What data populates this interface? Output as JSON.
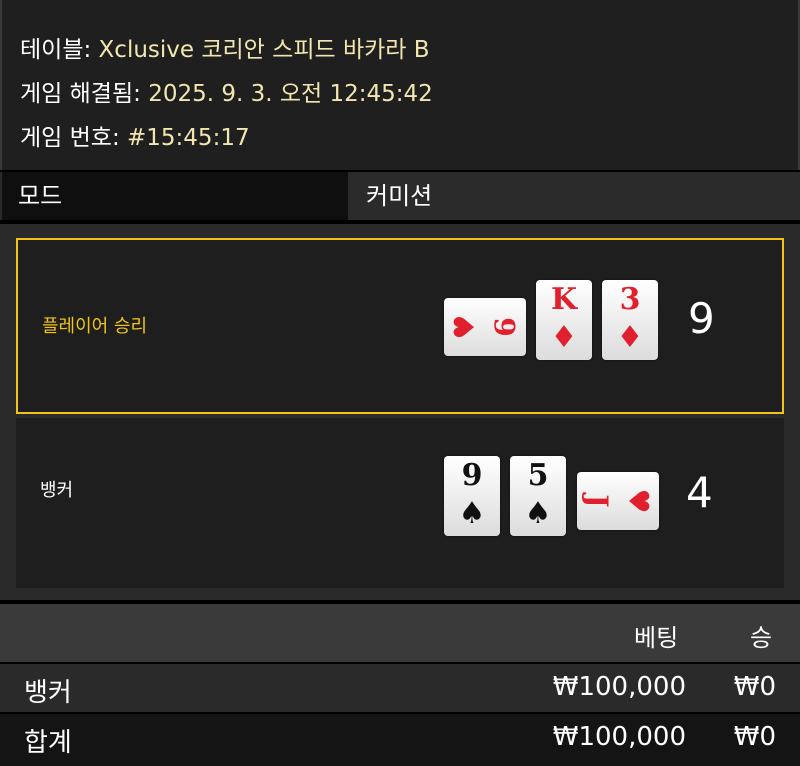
{
  "info": {
    "table_label": "테이블:",
    "table_value": "Xclusive 코리안 스피드 바카라 B",
    "resolved_label": "게임 해결됨:",
    "resolved_value": "2025. 9. 3. 오전 12:45:42",
    "game_no_label": "게임 번호:",
    "game_no_value": "#15:45:17"
  },
  "mode": {
    "label": "모드",
    "value": "커미션"
  },
  "results": {
    "player": {
      "label": "플레이어 승리",
      "score": "9",
      "cards": [
        {
          "rank": "6",
          "suit": "♥",
          "color": "#e0202c",
          "orientation": "horizontal"
        },
        {
          "rank": "K",
          "suit": "♦",
          "color": "#e0202c",
          "orientation": "vertical"
        },
        {
          "rank": "3",
          "suit": "♦",
          "color": "#e0202c",
          "orientation": "vertical"
        }
      ]
    },
    "banker": {
      "label": "뱅커",
      "score": "4",
      "cards": [
        {
          "rank": "9",
          "suit": "♠",
          "color": "#111111",
          "orientation": "vertical"
        },
        {
          "rank": "5",
          "suit": "♠",
          "color": "#111111",
          "orientation": "vertical"
        },
        {
          "rank": "J",
          "suit": "♥",
          "color": "#e0202c",
          "orientation": "horizontal"
        }
      ]
    },
    "winner_accent": "#f0c419"
  },
  "bets": {
    "headers": {
      "bet": "베팅",
      "win": "승"
    },
    "rows": [
      {
        "name": "뱅커",
        "bet": "₩100,000",
        "win": "₩0"
      },
      {
        "name": "합계",
        "bet": "₩100,000",
        "win": "₩0"
      }
    ]
  }
}
